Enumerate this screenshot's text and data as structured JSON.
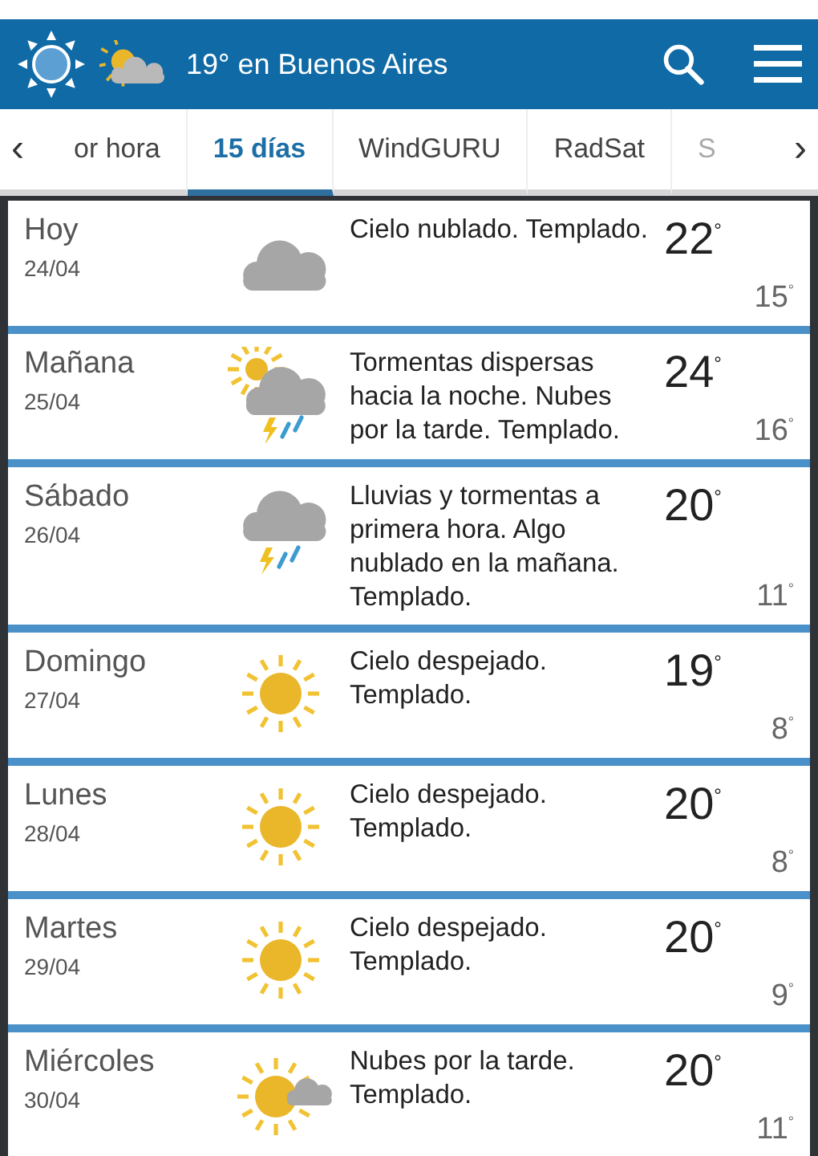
{
  "header": {
    "title": "19° en Buenos Aires"
  },
  "tabs": [
    {
      "label": "or hora",
      "selected": false
    },
    {
      "label": "15 días",
      "selected": true
    },
    {
      "label": "WindGURU",
      "selected": false
    },
    {
      "label": "RadSat",
      "selected": false
    },
    {
      "label": "S",
      "selected": false
    }
  ],
  "tab_arrows": {
    "left": "‹",
    "right": "›"
  },
  "days": [
    {
      "day": "Hoy",
      "date": "24/04",
      "kind": "cloud",
      "description": "Cielo nublado. Templado.",
      "max": "22$^{°}$",
      "min": "15$^{°}$"
    },
    {
      "day": "Mañana",
      "date": "25/04",
      "kind": "sun-cloud-storm",
      "description": "Tormentas dispersas hacia la noche. Nubes por la tarde. Templado.",
      "max": "24$^{°}$",
      "min": "16$^{°}$"
    },
    {
      "day": "Sábado",
      "date": "26/04",
      "kind": "cloud-storm",
      "description": "Lluvias y tormentas a primera hora. Algo nublado en la mañana. Templado.",
      "max": "20$^{°}$",
      "min": "11$^{°}$"
    },
    {
      "day": "Domingo",
      "date": "27/04",
      "kind": "sun",
      "description": "Cielo despejado. Templado.",
      "max": "19$^{°}$",
      "min": "8$^{°}$"
    },
    {
      "day": "Lunes",
      "date": "28/04",
      "kind": "sun",
      "description": "Cielo despejado. Templado.",
      "max": "20$^{°}$",
      "min": "8$^{°}$"
    },
    {
      "day": "Martes",
      "date": "29/04",
      "kind": "sun",
      "description": "Cielo despejado. Templado.",
      "max": "20$^{°}$",
      "min": "9$^{°}$"
    },
    {
      "day": "Miércoles",
      "date": "30/04",
      "kind": "sun-cloud",
      "description": "Nubes por la tarde. Templado.",
      "max": "20$^{°}$",
      "min": "11$^{°}$"
    }
  ]
}
